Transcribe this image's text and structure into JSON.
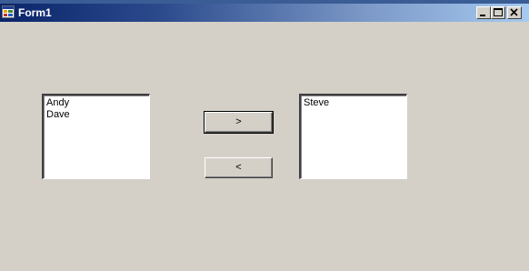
{
  "window": {
    "title": "Form1"
  },
  "left_list": {
    "items": [
      "Andy",
      "Dave"
    ]
  },
  "right_list": {
    "items": [
      "Steve"
    ]
  },
  "buttons": {
    "move_right": ">",
    "move_left": "<"
  },
  "icons": {
    "app": "form-app-icon",
    "minimize": "minimize-icon",
    "maximize": "maximize-icon",
    "close": "close-icon"
  },
  "colors": {
    "titlebar_start": "#0a246a",
    "titlebar_end": "#a6caf0",
    "face": "#d4d0c8"
  }
}
